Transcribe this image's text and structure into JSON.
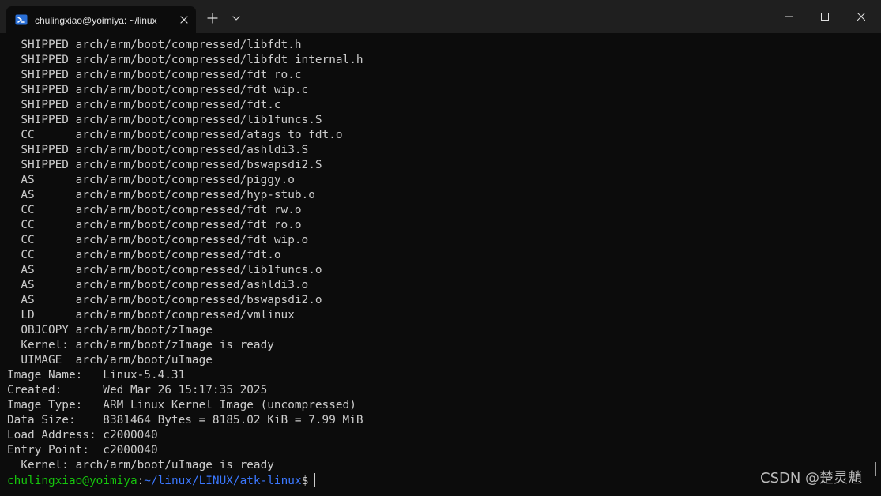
{
  "window": {
    "tab_title": "chulingxiao@yoimiya: ~/linux",
    "icons": {
      "tab": "powershell-terminal-icon",
      "tab_close": "close-icon",
      "new_tab": "plus-icon",
      "dropdown": "chevron-down-icon",
      "minimize": "minimize-icon",
      "maximize": "maximize-icon",
      "close": "close-icon"
    }
  },
  "terminal": {
    "build_lines": [
      "  SHIPPED arch/arm/boot/compressed/libfdt.h",
      "  SHIPPED arch/arm/boot/compressed/libfdt_internal.h",
      "  SHIPPED arch/arm/boot/compressed/fdt_ro.c",
      "  SHIPPED arch/arm/boot/compressed/fdt_wip.c",
      "  SHIPPED arch/arm/boot/compressed/fdt.c",
      "  SHIPPED arch/arm/boot/compressed/lib1funcs.S",
      "  CC      arch/arm/boot/compressed/atags_to_fdt.o",
      "  SHIPPED arch/arm/boot/compressed/ashldi3.S",
      "  SHIPPED arch/arm/boot/compressed/bswapsdi2.S",
      "  AS      arch/arm/boot/compressed/piggy.o",
      "  AS      arch/arm/boot/compressed/hyp-stub.o",
      "  CC      arch/arm/boot/compressed/fdt_rw.o",
      "  CC      arch/arm/boot/compressed/fdt_ro.o",
      "  CC      arch/arm/boot/compressed/fdt_wip.o",
      "  CC      arch/arm/boot/compressed/fdt.o",
      "  AS      arch/arm/boot/compressed/lib1funcs.o",
      "  AS      arch/arm/boot/compressed/ashldi3.o",
      "  AS      arch/arm/boot/compressed/bswapsdi2.o",
      "  LD      arch/arm/boot/compressed/vmlinux",
      "  OBJCOPY arch/arm/boot/zImage",
      "  Kernel: arch/arm/boot/zImage is ready",
      "  UIMAGE  arch/arm/boot/uImage",
      "Image Name:   Linux-5.4.31",
      "Created:      Wed Mar 26 15:17:35 2025",
      "Image Type:   ARM Linux Kernel Image (uncompressed)",
      "Data Size:    8381464 Bytes = 8185.02 KiB = 7.99 MiB",
      "Load Address: c2000040",
      "Entry Point:  c2000040",
      "  Kernel: arch/arm/boot/uImage is ready"
    ],
    "prompt": {
      "user_host": "chulingxiao@yoimiya",
      "colon": ":",
      "path": "~/linux/LINUX/atk-linux",
      "symbol": "$"
    }
  },
  "watermark": "CSDN @楚灵魈",
  "colors": {
    "background": "#0c0c0c",
    "titlebar": "#1f1f1f",
    "text": "#cccccc",
    "prompt_user": "#16c60c",
    "prompt_path": "#3b78ff"
  }
}
